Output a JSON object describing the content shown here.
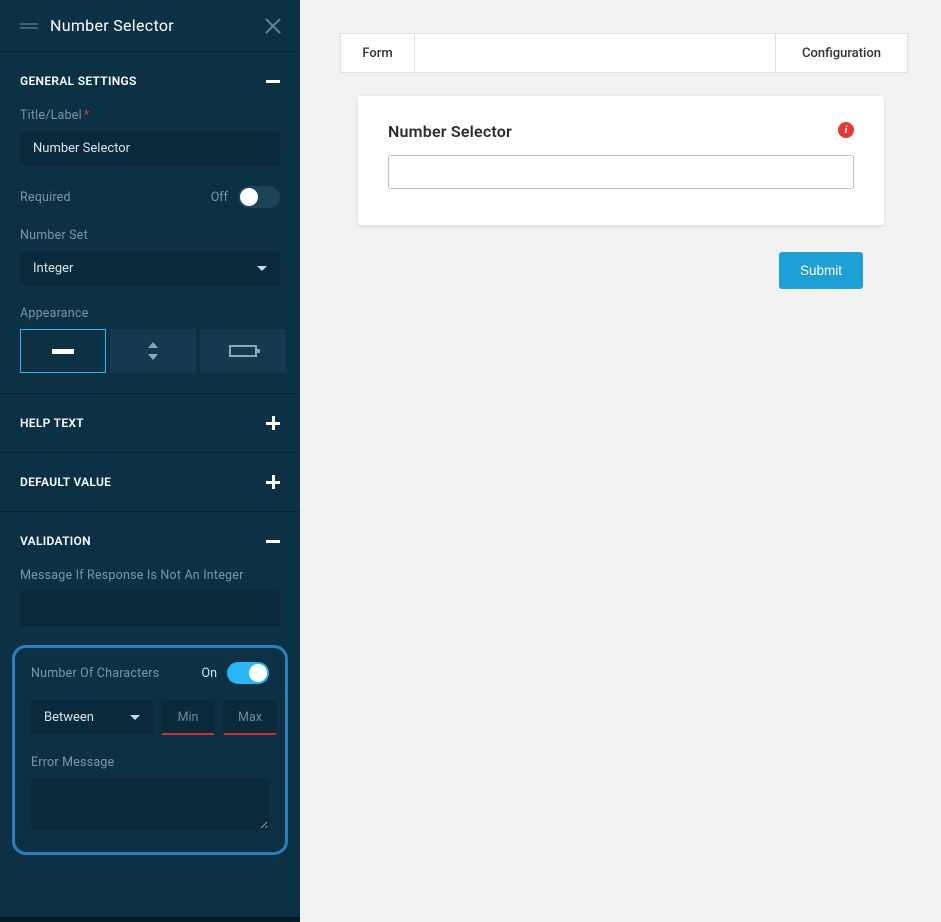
{
  "sidebar": {
    "title": "Number Selector",
    "sections": {
      "general": {
        "heading": "GENERAL SETTINGS",
        "title_label": "Title/Label",
        "title_value": "Number Selector",
        "required_label": "Required",
        "required_state": "Off",
        "number_set_label": "Number Set",
        "number_set_value": "Integer",
        "appearance_label": "Appearance"
      },
      "help_text": {
        "heading": "HELP TEXT"
      },
      "default_value": {
        "heading": "DEFAULT VALUE"
      },
      "validation": {
        "heading": "VALIDATION",
        "not_integer_label": "Message If Response Is Not An Integer",
        "not_integer_value": "",
        "num_chars_label": "Number Of Characters",
        "num_chars_state": "On",
        "range_mode": "Between",
        "min_placeholder": "Min",
        "max_placeholder": "Max",
        "error_msg_label": "Error Message",
        "error_msg_value": ""
      }
    }
  },
  "canvas": {
    "tabs": {
      "form": "Form",
      "configuration": "Configuration"
    },
    "card": {
      "title": "Number Selector",
      "input_value": ""
    },
    "submit_label": "Submit"
  }
}
